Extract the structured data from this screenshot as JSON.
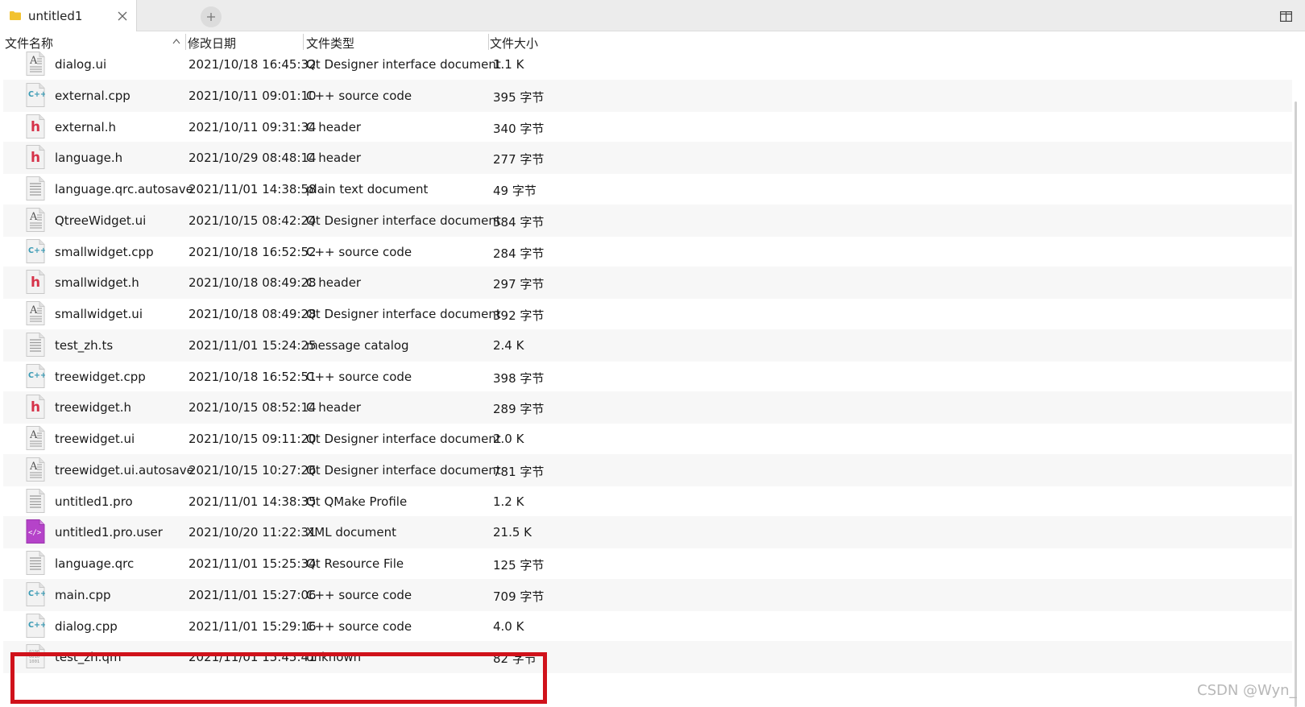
{
  "tab": {
    "title": "untitled1"
  },
  "columns": {
    "name": "文件名称",
    "date": "修改日期",
    "type": "文件类型",
    "size": "文件大小"
  },
  "files": [
    {
      "name": "dialog.ui",
      "date": "2021/10/18 16:45:32",
      "type": "Qt Designer interface document",
      "size": "1.1 K",
      "icon": "ui-file-icon"
    },
    {
      "name": "external.cpp",
      "date": "2021/10/11 09:01:10",
      "type": "C++ source code",
      "size": "395 字节",
      "icon": "cpp-file-icon"
    },
    {
      "name": "external.h",
      "date": "2021/10/11 09:31:34",
      "type": "C header",
      "size": "340 字节",
      "icon": "header-file-icon"
    },
    {
      "name": "language.h",
      "date": "2021/10/29 08:48:14",
      "type": "C header",
      "size": "277 字节",
      "icon": "header-file-icon"
    },
    {
      "name": "language.qrc.autosave",
      "date": "2021/11/01 14:38:58",
      "type": "plain text document",
      "size": "49 字节",
      "icon": "text-file-icon"
    },
    {
      "name": "QtreeWidget.ui",
      "date": "2021/10/15 08:42:24",
      "type": "Qt Designer interface document",
      "size": "584 字节",
      "icon": "ui-file-icon"
    },
    {
      "name": "smallwidget.cpp",
      "date": "2021/10/18 16:52:52",
      "type": "C++ source code",
      "size": "284 字节",
      "icon": "cpp-file-icon"
    },
    {
      "name": "smallwidget.h",
      "date": "2021/10/18 08:49:28",
      "type": "C header",
      "size": "297 字节",
      "icon": "header-file-icon"
    },
    {
      "name": "smallwidget.ui",
      "date": "2021/10/18 08:49:28",
      "type": "Qt Designer interface document",
      "size": "392 字节",
      "icon": "ui-file-icon"
    },
    {
      "name": "test_zh.ts",
      "date": "2021/11/01 15:24:25",
      "type": "message catalog",
      "size": "2.4 K",
      "icon": "text-file-icon"
    },
    {
      "name": "treewidget.cpp",
      "date": "2021/10/18 16:52:51",
      "type": "C++ source code",
      "size": "398 字节",
      "icon": "cpp-file-icon"
    },
    {
      "name": "treewidget.h",
      "date": "2021/10/15 08:52:14",
      "type": "C header",
      "size": "289 字节",
      "icon": "header-file-icon"
    },
    {
      "name": "treewidget.ui",
      "date": "2021/10/15 09:11:20",
      "type": "Qt Designer interface document",
      "size": "2.0 K",
      "icon": "ui-file-icon"
    },
    {
      "name": "treewidget.ui.autosave",
      "date": "2021/10/15 10:27:26",
      "type": "Qt Designer interface document",
      "size": "781 字节",
      "icon": "ui-file-icon"
    },
    {
      "name": "untitled1.pro",
      "date": "2021/11/01 14:38:35",
      "type": "Qt QMake Profile",
      "size": "1.2 K",
      "icon": "text-file-icon"
    },
    {
      "name": "untitled1.pro.user",
      "date": "2021/10/20 11:22:31",
      "type": "XML document",
      "size": "21.5 K",
      "icon": "xml-file-icon"
    },
    {
      "name": "language.qrc",
      "date": "2021/11/01 15:25:34",
      "type": "Qt Resource File",
      "size": "125 字节",
      "icon": "text-file-icon"
    },
    {
      "name": "main.cpp",
      "date": "2021/11/01 15:27:06",
      "type": "C++ source code",
      "size": "709 字节",
      "icon": "cpp-file-icon"
    },
    {
      "name": "dialog.cpp",
      "date": "2021/11/01 15:29:16",
      "type": "C++ source code",
      "size": "4.0 K",
      "icon": "cpp-file-icon"
    },
    {
      "name": "test_zh.qm",
      "date": "2021/11/01 15:45:41",
      "type": "unknown",
      "size": "82 字节",
      "icon": "binary-file-icon"
    }
  ],
  "highlighted_file": "test_zh.qm",
  "watermark": "CSDN @Wyn_",
  "colors": {
    "highlight": "#d0121b",
    "cpp_icon": "#3a9bb5",
    "header_icon": "#d6334a",
    "xml_icon": "#b543c9"
  }
}
